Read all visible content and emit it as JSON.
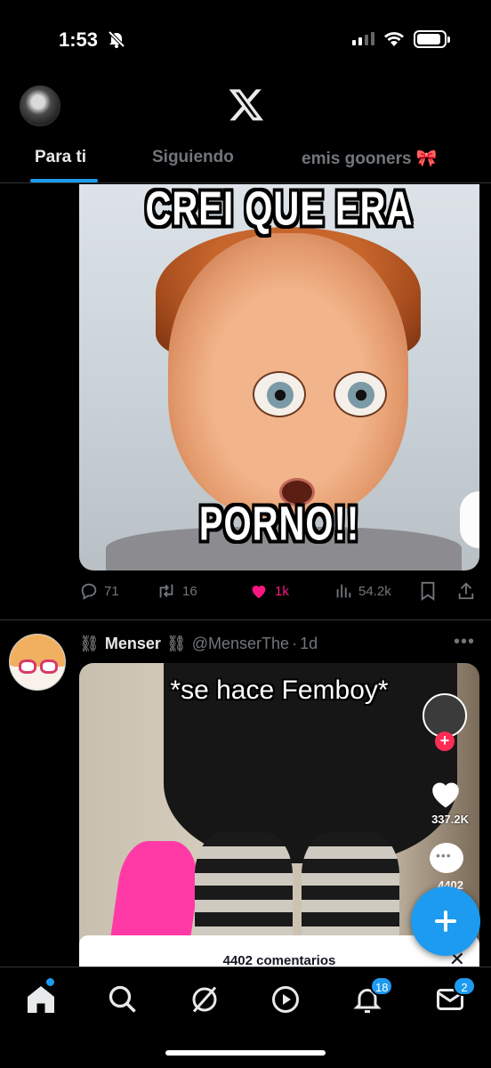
{
  "status_bar": {
    "time": "1:53"
  },
  "header": {
    "tabs": [
      {
        "label": "Para ti"
      },
      {
        "label": "Siguiendo"
      },
      {
        "label": "emis gooners 🎀"
      }
    ]
  },
  "tweet1": {
    "meme_top_text": "CREI QUE ERA",
    "meme_bottom_text": "PORNO!!",
    "replies": "71",
    "reposts": "16",
    "likes": "1k",
    "views": "54.2k"
  },
  "tweet2": {
    "author_name": "Menser",
    "author_decoration": "⛓",
    "handle": "@MenserThe",
    "separator": "·",
    "time": "1d",
    "more_label": "•••",
    "caption": "*se hace Femboy*",
    "tiktok_likes": "337.2K",
    "tiktok_comments": "4402",
    "comments_sheet_title": "4402 comentarios",
    "comments_close": "✕"
  },
  "bottom_nav": {
    "notifications_badge": "18",
    "messages_badge": "2"
  },
  "colors": {
    "accent": "#1d9bf0",
    "like": "#f91880",
    "muted": "#71767b"
  }
}
